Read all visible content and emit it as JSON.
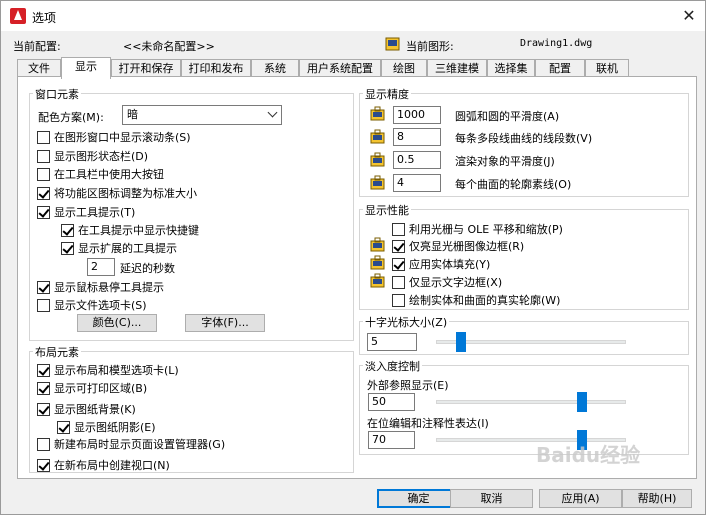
{
  "window": {
    "title": "选项",
    "close_glyph": "✕",
    "profile_label": "当前配置:",
    "profile_value": "<<未命名配置>>",
    "drawing_label": "当前图形:",
    "drawing_value": "Drawing1.dwg"
  },
  "tabs": [
    "文件",
    "显示",
    "打开和保存",
    "打印和发布",
    "系统",
    "用户系统配置",
    "绘图",
    "三维建模",
    "选择集",
    "配置",
    "联机"
  ],
  "active_tab": "显示",
  "window_elements": {
    "title": "窗口元素",
    "color_scheme_label": "配色方案(M):",
    "color_scheme_value": "暗",
    "options": [
      {
        "label": "在图形窗口中显示滚动条(S)",
        "checked": false
      },
      {
        "label": "显示图形状态栏(D)",
        "checked": false
      },
      {
        "label": "在工具栏中使用大按钮",
        "checked": false
      },
      {
        "label": "将功能区图标调整为标准大小",
        "checked": true
      },
      {
        "label": "显示工具提示(T)",
        "checked": true
      },
      {
        "label": "在工具提示中显示快捷键",
        "checked": true
      },
      {
        "label": "显示扩展的工具提示",
        "checked": true
      },
      {
        "label": "显示鼠标悬停工具提示",
        "checked": true
      },
      {
        "label": "显示文件选项卡(S)",
        "checked": false
      }
    ],
    "delay_value": "2",
    "delay_label": "延迟的秒数",
    "colors_button": "颜色(C)...",
    "fonts_button": "字体(F)..."
  },
  "layout_elements": {
    "title": "布局元素",
    "options": [
      {
        "label": "显示布局和模型选项卡(L)",
        "checked": true
      },
      {
        "label": "显示可打印区域(B)",
        "checked": true
      },
      {
        "label": "显示图纸背景(K)",
        "checked": true
      },
      {
        "label": "显示图纸阴影(E)",
        "checked": true
      },
      {
        "label": "新建布局时显示页面设置管理器(G)",
        "checked": false
      },
      {
        "label": "在新布局中创建视口(N)",
        "checked": true
      }
    ]
  },
  "display_resolution": {
    "title": "显示精度",
    "items": [
      {
        "value": "1000",
        "label": "圆弧和圆的平滑度(A)"
      },
      {
        "value": "8",
        "label": "每条多段线曲线的线段数(V)"
      },
      {
        "value": "0.5",
        "label": "渲染对象的平滑度(J)"
      },
      {
        "value": "4",
        "label": "每个曲面的轮廓素线(O)"
      }
    ]
  },
  "display_performance": {
    "title": "显示性能",
    "options": [
      {
        "label": "利用光栅与 OLE 平移和缩放(P)",
        "checked": false
      },
      {
        "label": "仅亮显光栅图像边框(R)",
        "checked": true
      },
      {
        "label": "应用实体填充(Y)",
        "checked": true
      },
      {
        "label": "仅显示文字边框(X)",
        "checked": false
      },
      {
        "label": "绘制实体和曲面的真实轮廓(W)",
        "checked": false
      }
    ]
  },
  "crosshair": {
    "title": "十字光标大小(Z)",
    "value": "5",
    "slider_fraction": 0.05
  },
  "fade_control": {
    "title": "淡入度控制",
    "xref_label": "外部参照显示(E)",
    "xref_value": "50",
    "xref_fraction": 0.5,
    "inplace_label": "在位编辑和注释性表达(I)",
    "inplace_value": "70",
    "inplace_fraction": 0.7
  },
  "buttons": {
    "ok": "确定",
    "cancel": "取消",
    "apply": "应用(A)",
    "help": "帮助(H)"
  },
  "watermark": "Baidu经验"
}
